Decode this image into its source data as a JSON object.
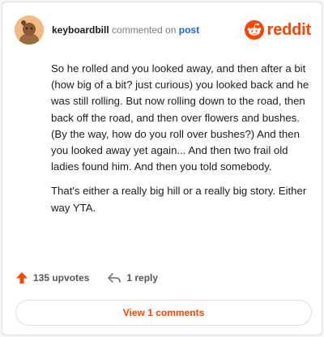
{
  "comment": {
    "username": "keyboardbill",
    "action_text": "commented on",
    "target_text": "post",
    "paragraphs": [
      "So he rolled and you looked away, and then after a bit (how big of a bit? just curious) you looked back and he was still rolling. But now rolling down to the road, then back off the road, and then over flowers and bushes. (By the way, how do you roll over bushes?) And then you looked away yet again... And then two frail old ladies found him. And then you told somebody.",
      "That's either a really big hill or a really big story. Either way YTA."
    ]
  },
  "brand": {
    "name": "reddit",
    "color": "#ff4500"
  },
  "actions": {
    "upvotes": "135 upvotes",
    "replies": "1 reply"
  },
  "view_comments_label": "View 1 comments"
}
